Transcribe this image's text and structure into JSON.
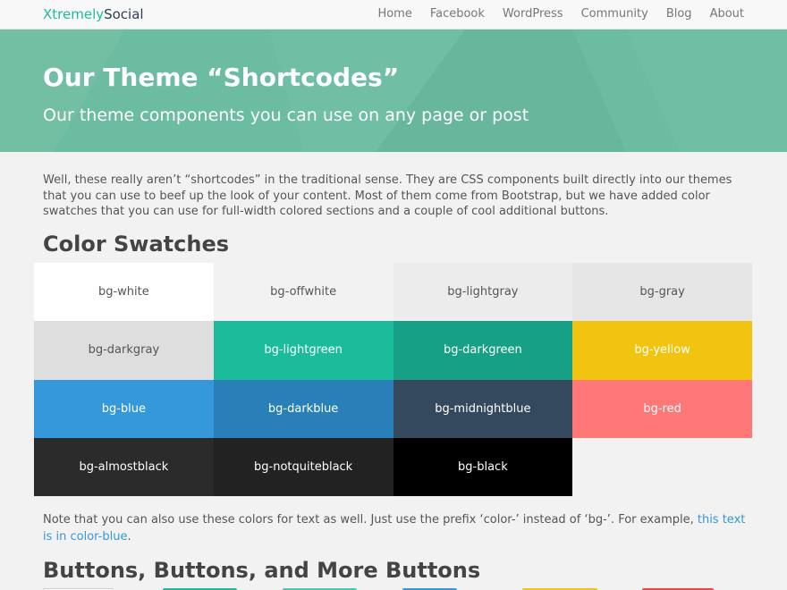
{
  "navbar": {
    "brand_part1": "Xtremely",
    "brand_part2": "Social",
    "items": [
      {
        "label": "Home"
      },
      {
        "label": "Facebook"
      },
      {
        "label": "WordPress"
      },
      {
        "label": "Community"
      },
      {
        "label": "Blog"
      },
      {
        "label": "About"
      }
    ]
  },
  "hero": {
    "title": "Our Theme “Shortcodes”",
    "subtitle": "Our theme components you can use on any page or post"
  },
  "intro": {
    "text": "Well, these really aren’t “shortcodes” in the traditional sense. They are CSS components built directly into our themes that you can use to beef up the look of your content. Most of them come from Bootstrap, but we have added color swatches that you can use for full-width colored sections and a couple of cool additional buttons."
  },
  "color_section": {
    "heading": "Color Swatches",
    "swatches": [
      {
        "label": "bg-white",
        "bg": "#ffffff",
        "fg": "#555555"
      },
      {
        "label": "bg-offwhite",
        "bg": "#f2f2f2",
        "fg": "#555555"
      },
      {
        "label": "bg-lightgray",
        "bg": "#ececec",
        "fg": "#555555"
      },
      {
        "label": "bg-gray",
        "bg": "#e6e6e6",
        "fg": "#555555"
      },
      {
        "label": "bg-darkgray",
        "bg": "#dedede",
        "fg": "#555555"
      },
      {
        "label": "bg-lightgreen",
        "bg": "#1abc9c",
        "fg": "#ffffff"
      },
      {
        "label": "bg-darkgreen",
        "bg": "#16a085",
        "fg": "#ffffff"
      },
      {
        "label": "bg-yellow",
        "bg": "#f1c40f",
        "fg": "#ffffff"
      },
      {
        "label": "bg-blue",
        "bg": "#3498db",
        "fg": "#ffffff"
      },
      {
        "label": "bg-darkblue",
        "bg": "#2980b9",
        "fg": "#ffffff"
      },
      {
        "label": "bg-midnightblue",
        "bg": "#34495e",
        "fg": "#ffffff"
      },
      {
        "label": "bg-red",
        "bg": "#ff7878",
        "fg": "#ffffff"
      },
      {
        "label": "bg-almostblack",
        "bg": "#2b2b2b",
        "fg": "#ffffff"
      },
      {
        "label": "bg-notquiteblack",
        "bg": "#222222",
        "fg": "#ffffff"
      },
      {
        "label": "bg-black",
        "bg": "#000000",
        "fg": "#ffffff"
      }
    ],
    "note_text": "Note that you can also use these colors for text as well. Just use the prefix ‘color-’ instead of ‘bg-’. For example, ",
    "note_link": "this text is in color-blue",
    "note_end": "."
  },
  "buttons_section": {
    "heading": "Buttons, Buttons, and More Buttons",
    "button_colors": [
      "#ffffff",
      "#1abc9c",
      "#48c9b0",
      "#3498db",
      "#f1c40f",
      "#e74c3c"
    ]
  },
  "colors": {
    "accent": "#1abc9c",
    "hero_bg": "#6bbca0",
    "link": "#3498db"
  }
}
